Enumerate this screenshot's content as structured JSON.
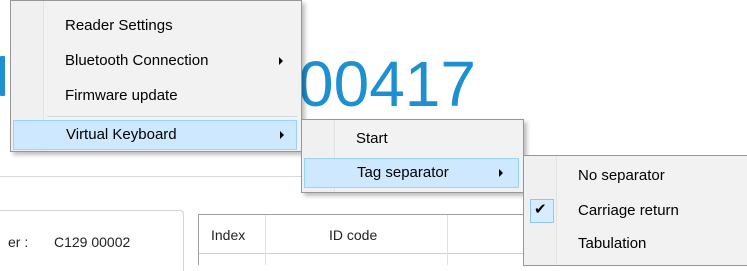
{
  "background": {
    "big_number": "00417",
    "reader": {
      "label": "er :",
      "value": "C129 00002"
    },
    "grid": {
      "headers": [
        "Index",
        "ID code"
      ]
    }
  },
  "menu_main": {
    "items": [
      {
        "label": "Reader Settings",
        "has_submenu": false
      },
      {
        "label": "Bluetooth Connection",
        "has_submenu": true
      },
      {
        "label": "Firmware update",
        "has_submenu": false
      },
      {
        "label": "Virtual Keyboard",
        "has_submenu": true,
        "highlighted": true
      }
    ]
  },
  "menu_virtual_keyboard": {
    "items": [
      {
        "label": "Start",
        "has_submenu": false
      },
      {
        "label": "Tag separator",
        "has_submenu": true,
        "highlighted": true
      }
    ]
  },
  "menu_tag_separator": {
    "items": [
      {
        "label": "No separator",
        "checked": false
      },
      {
        "label": "Carriage return",
        "checked": true
      },
      {
        "label": "Tabulation",
        "checked": false
      }
    ]
  },
  "colors": {
    "accent": "#1e8fd1",
    "menu_bg": "#f2f2f2",
    "highlight": "#cde8ff",
    "highlight_border": "#99d1ff"
  }
}
